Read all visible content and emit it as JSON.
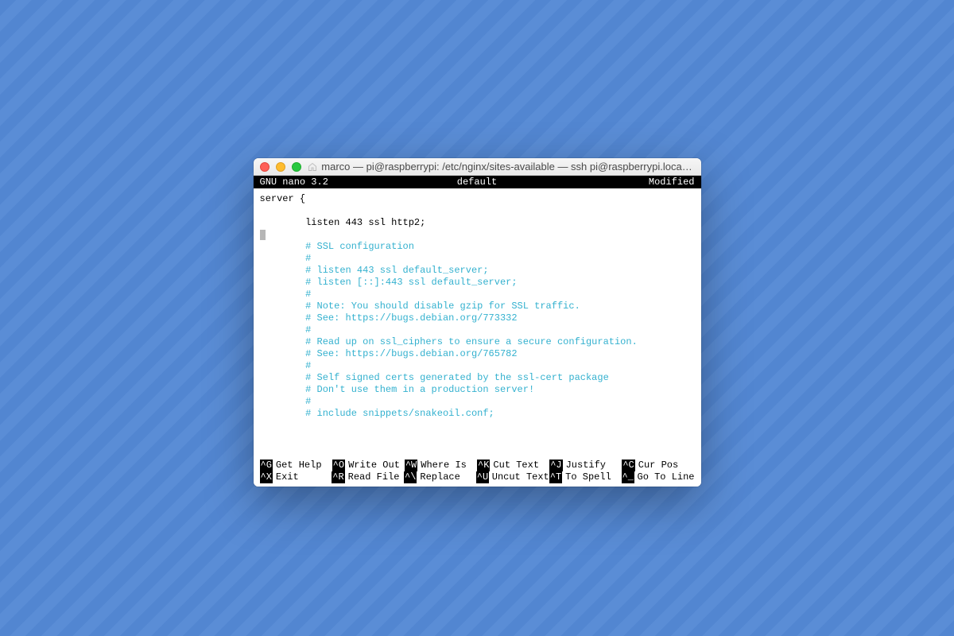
{
  "titlebar": {
    "title": "marco — pi@raspberrypi: /etc/nginx/sites-available — ssh pi@raspberrypi.loca…"
  },
  "nano": {
    "program": "  GNU nano 3.2",
    "filename": "default",
    "status": "Modified"
  },
  "editor": {
    "lines": [
      {
        "txt": "server {",
        "comment": false,
        "indent": 0
      },
      {
        "txt": "",
        "comment": false,
        "indent": 0
      },
      {
        "txt": "listen 443 ssl http2;",
        "comment": false,
        "indent": 8
      },
      {
        "txt": "",
        "comment": false,
        "indent": 0,
        "cursor": true
      },
      {
        "txt": "# SSL configuration",
        "comment": true,
        "indent": 8
      },
      {
        "txt": "#",
        "comment": true,
        "indent": 8
      },
      {
        "txt": "# listen 443 ssl default_server;",
        "comment": true,
        "indent": 8
      },
      {
        "txt": "# listen [::]:443 ssl default_server;",
        "comment": true,
        "indent": 8
      },
      {
        "txt": "#",
        "comment": true,
        "indent": 8
      },
      {
        "txt": "# Note: You should disable gzip for SSL traffic.",
        "comment": true,
        "indent": 8
      },
      {
        "txt": "# See: https://bugs.debian.org/773332",
        "comment": true,
        "indent": 8
      },
      {
        "txt": "#",
        "comment": true,
        "indent": 8
      },
      {
        "txt": "# Read up on ssl_ciphers to ensure a secure configuration.",
        "comment": true,
        "indent": 8
      },
      {
        "txt": "# See: https://bugs.debian.org/765782",
        "comment": true,
        "indent": 8
      },
      {
        "txt": "#",
        "comment": true,
        "indent": 8
      },
      {
        "txt": "# Self signed certs generated by the ssl-cert package",
        "comment": true,
        "indent": 8
      },
      {
        "txt": "# Don't use them in a production server!",
        "comment": true,
        "indent": 8
      },
      {
        "txt": "#",
        "comment": true,
        "indent": 8
      },
      {
        "txt": "# include snippets/snakeoil.conf;",
        "comment": true,
        "indent": 8
      }
    ]
  },
  "shortcuts": {
    "row1": [
      {
        "key": "^G",
        "label": "Get Help"
      },
      {
        "key": "^O",
        "label": "Write Out"
      },
      {
        "key": "^W",
        "label": "Where Is"
      },
      {
        "key": "^K",
        "label": "Cut Text"
      },
      {
        "key": "^J",
        "label": "Justify"
      },
      {
        "key": "^C",
        "label": "Cur Pos"
      }
    ],
    "row2": [
      {
        "key": "^X",
        "label": "Exit"
      },
      {
        "key": "^R",
        "label": "Read File"
      },
      {
        "key": "^\\",
        "label": "Replace"
      },
      {
        "key": "^U",
        "label": "Uncut Text"
      },
      {
        "key": "^T",
        "label": "To Spell"
      },
      {
        "key": "^_",
        "label": "Go To Line"
      }
    ]
  }
}
